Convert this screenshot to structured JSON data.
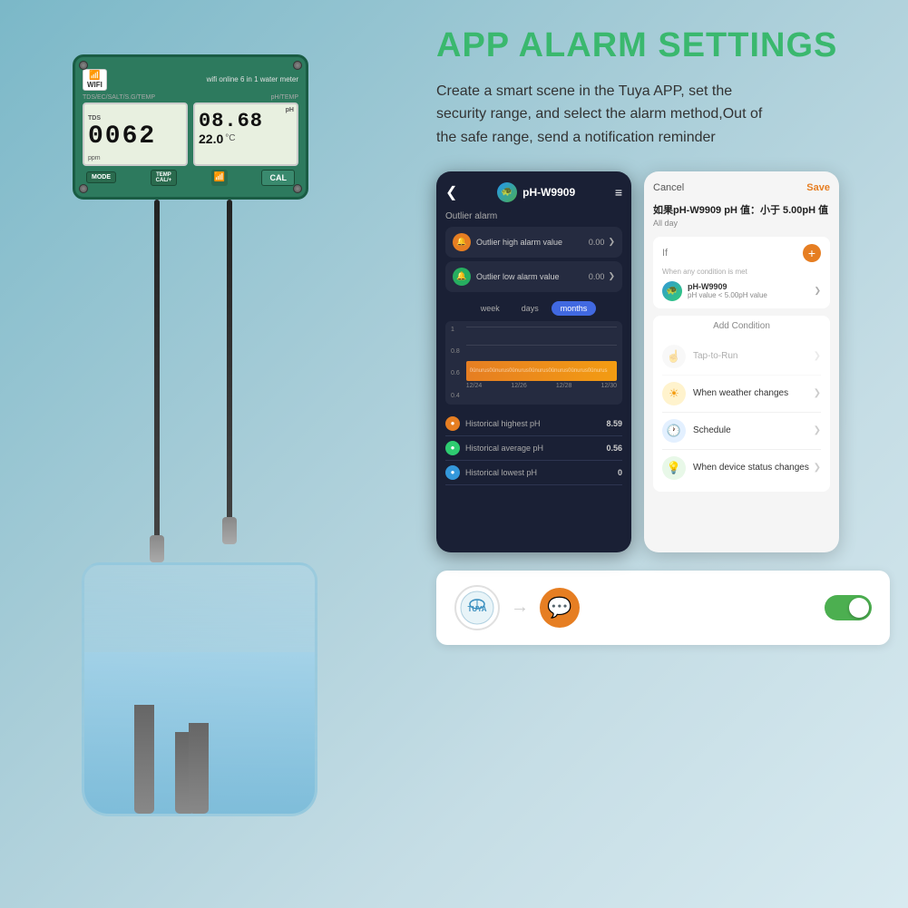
{
  "page": {
    "background": "linear-gradient(135deg, #7bb8c8 0%, #a8cdd8 40%, #c5dde5 70%, #d8eaf0 100%)"
  },
  "device": {
    "wifi_label": "WIFI",
    "title": "wifi online 6 in 1 water meter",
    "left_panel_label": "TDS/EC/SALT/S.G/TEMP",
    "right_panel_label": "pH/TEMP",
    "tds_label": "TDS",
    "tds_value": "0062",
    "tds_unit": "ppm",
    "ph_value": "08.68",
    "temp_value": "22.0",
    "temp_unit": "°C",
    "btn_mode": "MODE",
    "btn_temp_cal": "TEMP\nCAL/+",
    "btn_wifi": "WiFi",
    "btn_cal": "CAL"
  },
  "right_section": {
    "app_title": "APP ALARM SETTINGS",
    "description": "Create a smart scene in the Tuya APP, set the security range, and select the alarm method,Out of the safe range, send a notification reminder"
  },
  "phone_dark": {
    "title": "pH-W9909",
    "back_arrow": "❮",
    "menu_icon": "≡",
    "outlier_alarm_label": "Outlier alarm",
    "alarm_high_label": "Outlier high alarm value",
    "alarm_high_value": "0.00",
    "alarm_low_label": "Outlier low alarm value",
    "alarm_low_value": "0.00",
    "time_tabs": [
      "week",
      "days",
      "months"
    ],
    "active_tab": "months",
    "chart_y_labels": [
      "1",
      "0.8",
      "0.6",
      "0.4"
    ],
    "chart_x_labels": [
      "12/24",
      "12/26",
      "12/28",
      "12/30"
    ],
    "chart_bar_text": "0ûnurus0ûnurus0ûnurus0ûnurus0ûnurus0ûnurus0ûnurus",
    "stats": [
      {
        "label": "Historical highest pH",
        "value": "8.59",
        "color": "#e67e22"
      },
      {
        "label": "Historical average pH",
        "value": "0.56",
        "color": "#2ecc71"
      },
      {
        "label": "Historical lowest pH",
        "value": "0",
        "color": "#3498db"
      }
    ]
  },
  "phone_light": {
    "cancel_label": "Cancel",
    "save_label": "Save",
    "condition_title": "如果pH-W9909 pH 值：小于 5.00pH 值",
    "condition_subtitle": "All day",
    "if_label": "If",
    "if_condition_desc": "When any condition is met",
    "device_name": "pH-W9909",
    "device_condition": "pH value < 5.00pH value",
    "dots": "...",
    "add_condition_title": "Add Condition",
    "conditions": [
      {
        "label": "Tap-to-Run",
        "icon": "👆",
        "icon_bg": "#f0f0f0",
        "disabled": true,
        "arrow": "❯"
      },
      {
        "label": "When weather changes",
        "icon": "☀",
        "icon_bg": "#fff3cd",
        "disabled": false,
        "arrow": "❯"
      },
      {
        "label": "Schedule",
        "icon": "🕐",
        "icon_bg": "#e3f0ff",
        "disabled": false,
        "arrow": "❯"
      },
      {
        "label": "When device status changes",
        "icon": "💡",
        "icon_bg": "#e8f8e8",
        "disabled": false,
        "arrow": "❯"
      }
    ]
  },
  "bottom_card": {
    "arrow": "→",
    "toggle_state": "on"
  }
}
